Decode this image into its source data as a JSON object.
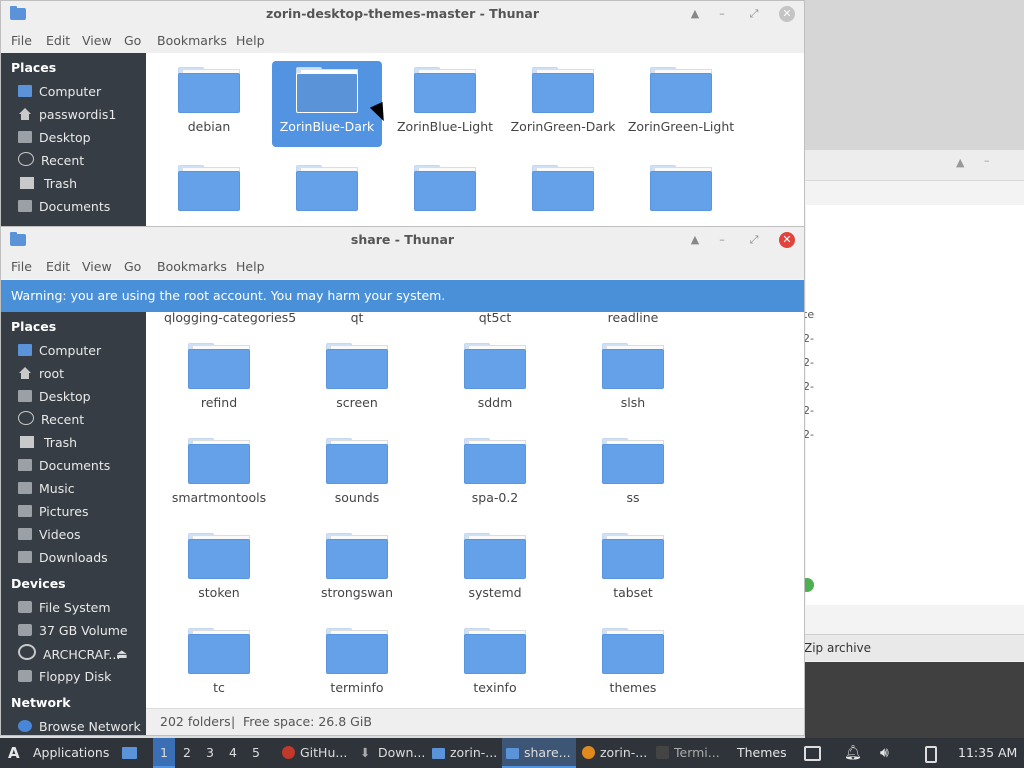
{
  "bg_window": {
    "zip_label": "Zip archive",
    "stub_col": "te",
    "stub_rows": [
      "2-",
      "2-",
      "2-",
      "2-",
      "2-"
    ]
  },
  "win_top": {
    "title": "zorin-desktop-themes-master - Thunar",
    "menu": [
      "File",
      "Edit",
      "View",
      "Go",
      "Bookmarks",
      "Help"
    ],
    "places_header": "Places",
    "places": [
      {
        "label": "Computer",
        "icon": "computer-icon"
      },
      {
        "label": "passwordis1",
        "icon": "home-icon"
      },
      {
        "label": "Desktop",
        "icon": "folder-icon"
      },
      {
        "label": "Recent",
        "icon": "recent-icon"
      },
      {
        "label": "Trash",
        "icon": "trash-icon"
      },
      {
        "label": "Documents",
        "icon": "folder-icon"
      }
    ],
    "folders": [
      "debian",
      "ZorinBlue-Dark",
      "ZorinBlue-Light",
      "ZorinGreen-Dark",
      "ZorinGreen-Light",
      "",
      "",
      "",
      "",
      ""
    ],
    "selected": "ZorinBlue-Dark"
  },
  "win_main": {
    "title": "share - Thunar",
    "menu": [
      "File",
      "Edit",
      "View",
      "Go",
      "Bookmarks",
      "Help"
    ],
    "warning": "Warning: you are using the root account. You may harm your system.",
    "places_header": "Places",
    "places": [
      {
        "label": "Computer",
        "icon": "computer-icon"
      },
      {
        "label": "root",
        "icon": "home-icon"
      },
      {
        "label": "Desktop",
        "icon": "folder-icon"
      },
      {
        "label": "Recent",
        "icon": "recent-icon"
      },
      {
        "label": "Trash",
        "icon": "trash-icon"
      },
      {
        "label": "Documents",
        "icon": "folder-icon"
      },
      {
        "label": "Music",
        "icon": "folder-icon"
      },
      {
        "label": "Pictures",
        "icon": "folder-icon"
      },
      {
        "label": "Videos",
        "icon": "folder-icon"
      },
      {
        "label": "Downloads",
        "icon": "folder-icon"
      }
    ],
    "devices_header": "Devices",
    "devices": [
      {
        "label": "File System",
        "icon": "disk-icon"
      },
      {
        "label": "37 GB Volume",
        "icon": "disk-icon"
      },
      {
        "label": "ARCHCRAF...",
        "icon": "cd-icon"
      },
      {
        "label": "Floppy Disk",
        "icon": "disk-icon"
      }
    ],
    "network_header": "Network",
    "network": [
      {
        "label": "Browse Network",
        "icon": "globe-icon"
      }
    ],
    "partial_row": [
      "qlogging-categories5",
      "qt",
      "qt5ct",
      "readline"
    ],
    "folders": [
      "refind",
      "screen",
      "sddm",
      "slsh",
      "smartmontools",
      "sounds",
      "spa-0.2",
      "ss",
      "stoken",
      "strongswan",
      "systemd",
      "tabset",
      "tc",
      "terminfo",
      "texinfo",
      "themes"
    ],
    "status": {
      "count": "202 folders",
      "sep": "|",
      "free": "Free space: 26.8 GiB"
    }
  },
  "taskbar": {
    "apps_label": "Applications",
    "workspaces": [
      "1",
      "2",
      "3",
      "4",
      "5"
    ],
    "active_workspace": "1",
    "tasks": [
      {
        "label": "GitHu...",
        "icon": "browser-icon",
        "color": "#c0392b"
      },
      {
        "label": "Down...",
        "icon": "download-icon",
        "color": "#888888"
      },
      {
        "label": "zorin-...",
        "icon": "folder-icon",
        "color": "#5a93d8"
      },
      {
        "label": "share...",
        "icon": "folder-icon",
        "color": "#5a93d8",
        "active": true
      },
      {
        "label": "zorin-...",
        "icon": "archive-icon",
        "color": "#e08a1e"
      },
      {
        "label": "Termi...",
        "icon": "terminal-icon",
        "color": "#444444"
      }
    ],
    "themes_label": "Themes",
    "clock": "11:35 AM"
  },
  "colors": {
    "accent": "#5294e2",
    "warning_bg": "#4a90d9",
    "sidebar_bg": "#363d44",
    "folder": "#64a1e9",
    "close_active": "#e0443d"
  }
}
